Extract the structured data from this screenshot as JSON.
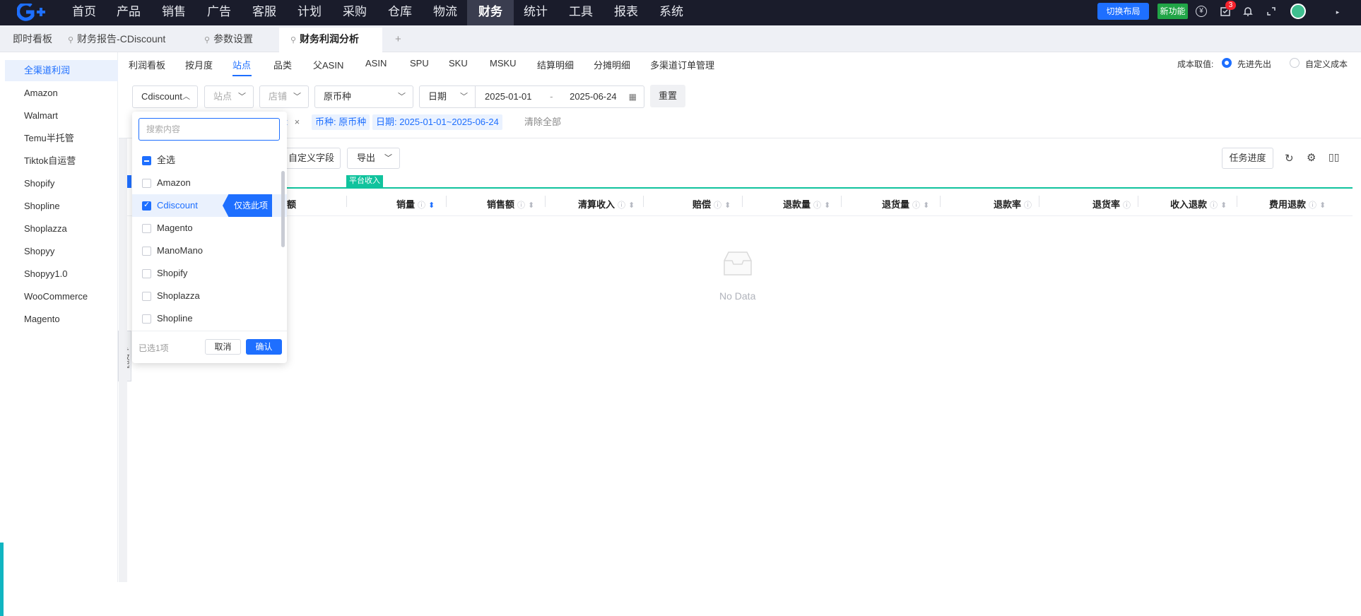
{
  "topnav": {
    "items": [
      "首页",
      "产品",
      "销售",
      "广告",
      "客服",
      "计划",
      "采购",
      "仓库",
      "物流",
      "财务",
      "统计",
      "工具",
      "报表",
      "系统"
    ],
    "active": "财务",
    "switch_layout": "切换布局",
    "new_feature": "新功能",
    "notification_count": "3",
    "icons": [
      "currency-icon",
      "task-icon",
      "bell-icon",
      "fullscreen-icon",
      "avatar",
      "caret-icon"
    ]
  },
  "page_tabs": {
    "pinned_home": "即时看板",
    "tabs": [
      "财务报告-CDiscount",
      "参数设置",
      "财务利润分析"
    ],
    "active": "财务利润分析",
    "add": "+"
  },
  "sidebar": {
    "items": [
      "全渠道利润",
      "Amazon",
      "Walmart",
      "Temu半托管",
      "Tiktok自运营",
      "Shopify",
      "Shopline",
      "Shoplazza",
      "Shopyy",
      "Shopyy1.0",
      "WooCommerce",
      "Magento"
    ],
    "active": "全渠道利润",
    "collapse_label": "<| 收起"
  },
  "subtabs": {
    "items": [
      "利润看板",
      "按月度",
      "站点",
      "品类",
      "父ASIN",
      "ASIN",
      "SPU",
      "SKU",
      "MSKU",
      "结算明细",
      "分摊明细",
      "多渠道订单管理"
    ],
    "active": "站点"
  },
  "cost_basis": {
    "label": "成本取值:",
    "options": [
      "先进先出",
      "自定义成本"
    ],
    "selected": "先进先出"
  },
  "filters": {
    "platform": "Cdiscount",
    "site_placeholder": "站点",
    "store_placeholder": "店铺",
    "currency": "原币种",
    "date_type": "日期",
    "date_start": "2025-01-01",
    "date_sep": "-",
    "date_end": "2025-06-24",
    "reset": "重置"
  },
  "active_filters": {
    "platform_tail": "t",
    "currency": "币种: 原币种",
    "date": "日期: 2025-01-01~2025-06-24",
    "clear_all": "清除全部"
  },
  "toolbar": {
    "custom_fields": "自定义字段",
    "export": "导出",
    "task_progress": "任务进度"
  },
  "table": {
    "group_label": "平台收入",
    "group_color": "#10c39d",
    "headers": [
      "销量",
      "销售额",
      "清算收入",
      "赔偿",
      "退款量",
      "退货量",
      "退款率",
      "退货率",
      "收入退款",
      "费用退款"
    ],
    "left_header_tail": "额",
    "empty_text": "No Data"
  },
  "dropdown": {
    "search_placeholder": "搜索内容",
    "select_all": "全选",
    "options": [
      "Amazon",
      "Cdiscount",
      "Magento",
      "ManoMano",
      "Shopify",
      "Shoplazza",
      "Shopline"
    ],
    "checked": [
      "Cdiscount"
    ],
    "only_this": "仅选此项",
    "selected_count": "已选1项",
    "cancel": "取消",
    "confirm": "确认"
  },
  "colors": {
    "accent": "#1e6fff",
    "nav_bg": "#1a1c2b",
    "new_feature": "#21a547",
    "teal": "#10c39d"
  }
}
